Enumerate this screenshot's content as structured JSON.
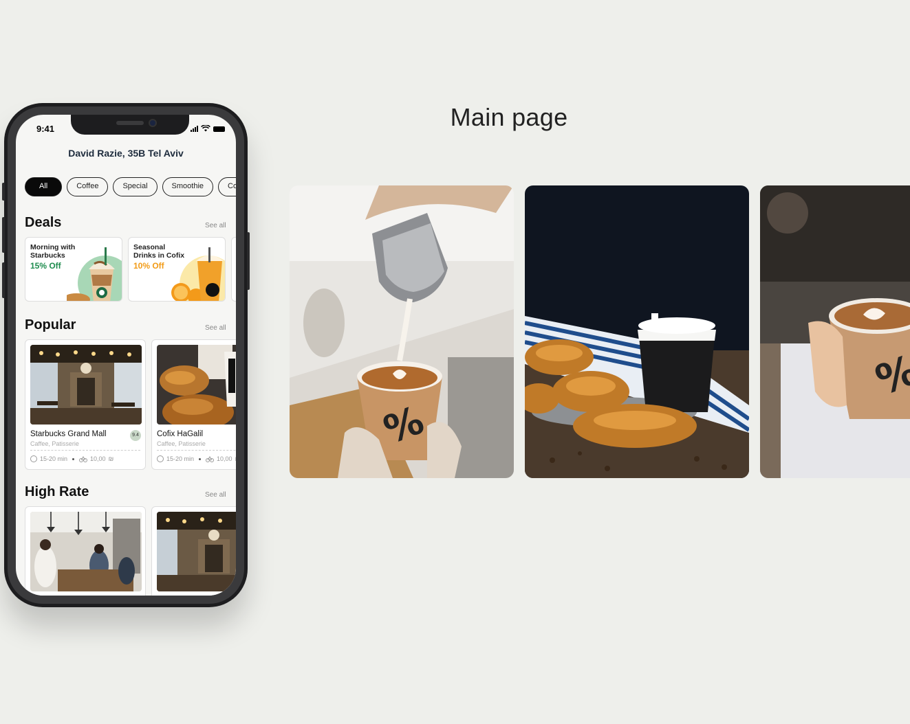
{
  "page": {
    "heading": "Main page"
  },
  "phone": {
    "status": {
      "time": "9:41"
    },
    "location": "David Razie, 35B Tel Aviv",
    "chips": [
      "All",
      "Coffee",
      "Special",
      "Smoothie",
      "Co"
    ],
    "deals": {
      "title": "Deals",
      "see_all": "See all",
      "items": [
        {
          "title": "Morning with Starbucks",
          "offer": "15% Off",
          "accent": "#1e8c4e"
        },
        {
          "title": "Seasonal Drinks in Cofix",
          "offer": "10% Off",
          "accent": "#f29b16"
        }
      ]
    },
    "popular": {
      "title": "Popular",
      "see_all": "See all",
      "items": [
        {
          "name": "Starbucks Grand Mall",
          "category": "Caffee, Patisserie",
          "rating": "9.4",
          "time": "15-20 min",
          "delivery": "10,00"
        },
        {
          "name": "Cofix HaGalil",
          "category": "Caffee, Patisserie",
          "time": "15-20 min",
          "delivery": "10,00"
        }
      ]
    },
    "high_rate": {
      "title": "High Rate",
      "see_all": "See all"
    },
    "delivery_currency": "₪"
  },
  "gallery": [
    "latte-art-pour-photo",
    "croissant-coffee-photo",
    "latte-cup-hand-photo"
  ]
}
